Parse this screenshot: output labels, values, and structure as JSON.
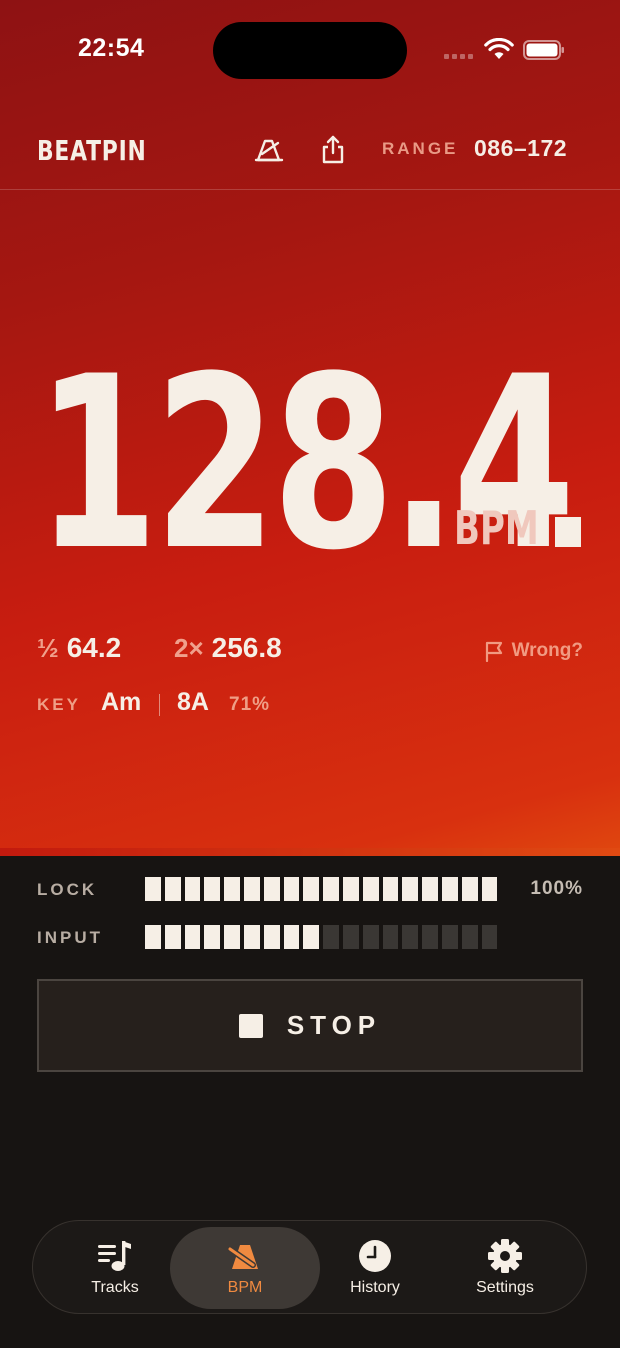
{
  "status_bar": {
    "time": "22:54"
  },
  "header": {
    "brand": "BEATPIN",
    "metronome_icon": "metronome-icon",
    "share_icon": "share-icon",
    "range_label": "RANGE",
    "range_value": "086–172"
  },
  "reading": {
    "bpm": "128.4",
    "unit": "BPM",
    "half_prefix": "½",
    "half_value": "64.2",
    "double_prefix": "2×",
    "double_value": "256.8",
    "wrong_label": "Wrong?",
    "key_label": "KEY",
    "key_value": "Am",
    "camelot": "8A",
    "confidence": "71%"
  },
  "meters": {
    "lock": {
      "label": "LOCK",
      "segments_total": 18,
      "level": 1.0,
      "percent": "100%"
    },
    "input": {
      "label": "INPUT",
      "segments_total": 18,
      "level": 0.5
    }
  },
  "stop_button": {
    "label": "STOP"
  },
  "tabs": [
    {
      "id": "tracks",
      "label": "Tracks",
      "icon": "tracks-icon",
      "active": false
    },
    {
      "id": "bpm",
      "label": "BPM",
      "icon": "metronome-icon",
      "active": true
    },
    {
      "id": "history",
      "label": "History",
      "icon": "clock-icon",
      "active": false
    },
    {
      "id": "settings",
      "label": "Settings",
      "icon": "gear-icon",
      "active": false
    }
  ],
  "colors": {
    "accent": "#f08a40",
    "hero_top": "#8e1213",
    "hero_bottom": "#e0480f",
    "cream": "#f6efe6",
    "dark_bg": "#171412"
  }
}
